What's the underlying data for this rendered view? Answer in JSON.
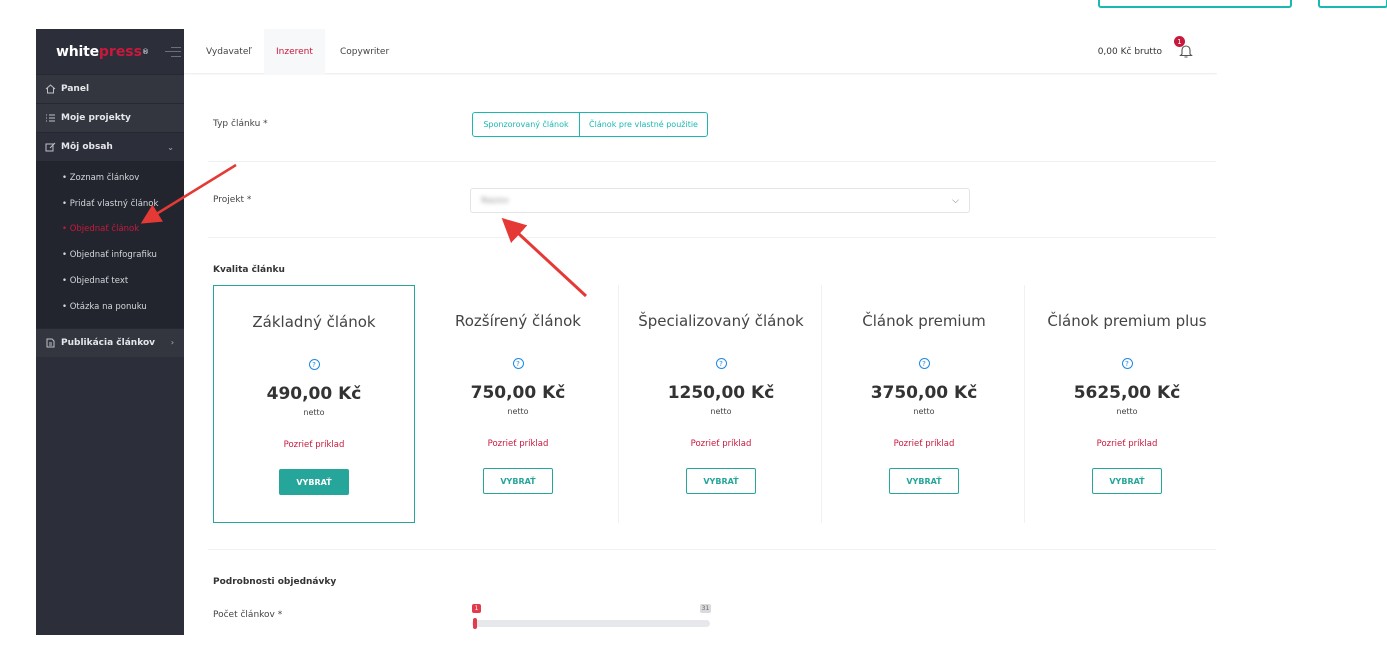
{
  "sidebar": {
    "logo_white": "white",
    "logo_press": "press",
    "logo_reg": "®",
    "items": [
      {
        "label": "Panel",
        "icon": "home-icon"
      },
      {
        "label": "Moje projekty",
        "icon": "list-icon"
      },
      {
        "label": "Môj obsah",
        "icon": "edit-icon"
      }
    ],
    "sub_items": [
      "• Zoznam článkov",
      "• Pridať vlastný článok",
      "• Objednať článok",
      "• Objednať infografiku",
      "• Objednať text",
      "• Otázka na ponuku"
    ],
    "active_sub_index": 2,
    "publish_label": "Publikácia článkov"
  },
  "header": {
    "tabs": [
      "Vydavateľ",
      "Inzerent",
      "Copywriter"
    ],
    "active_tab": "Inzerent",
    "balance": "0,00 Kč brutto",
    "notifications": "1"
  },
  "form": {
    "type_label": "Typ článku *",
    "type_options": [
      "Sponzorovaný článok",
      "Článok pre vlastné použitie"
    ],
    "project_label": "Projekt *",
    "project_value": "Nazov",
    "quality_title": "Kvalita článku",
    "details_title": "Podrobnosti objednávky",
    "count_label": "Počet článkov *",
    "count_min": "1",
    "count_max": "31"
  },
  "cards": [
    {
      "title": "Základný článok",
      "price": "490,00 Kč",
      "netto": "netto",
      "example": "Pozrieť príklad",
      "button": "VYBRAŤ",
      "selected": true
    },
    {
      "title": "Rozšírený článok",
      "price": "750,00 Kč",
      "netto": "netto",
      "example": "Pozrieť príklad",
      "button": "VYBRAŤ",
      "selected": false
    },
    {
      "title": "Špecializovaný článok",
      "price": "1250,00 Kč",
      "netto": "netto",
      "example": "Pozrieť príklad",
      "button": "VYBRAŤ",
      "selected": false
    },
    {
      "title": "Článok premium",
      "price": "3750,00 Kč",
      "netto": "netto",
      "example": "Pozrieť príklad",
      "button": "VYBRAŤ",
      "selected": false
    },
    {
      "title": "Článok premium plus",
      "price": "5625,00 Kč",
      "netto": "netto",
      "example": "Pozrieť príklad",
      "button": "VYBRAŤ",
      "selected": false
    }
  ],
  "colors": {
    "accent": "#26a69a",
    "brand": "#c8193c",
    "sidebar": "#2c2f3a",
    "annotation_arrow": "#e53935"
  }
}
